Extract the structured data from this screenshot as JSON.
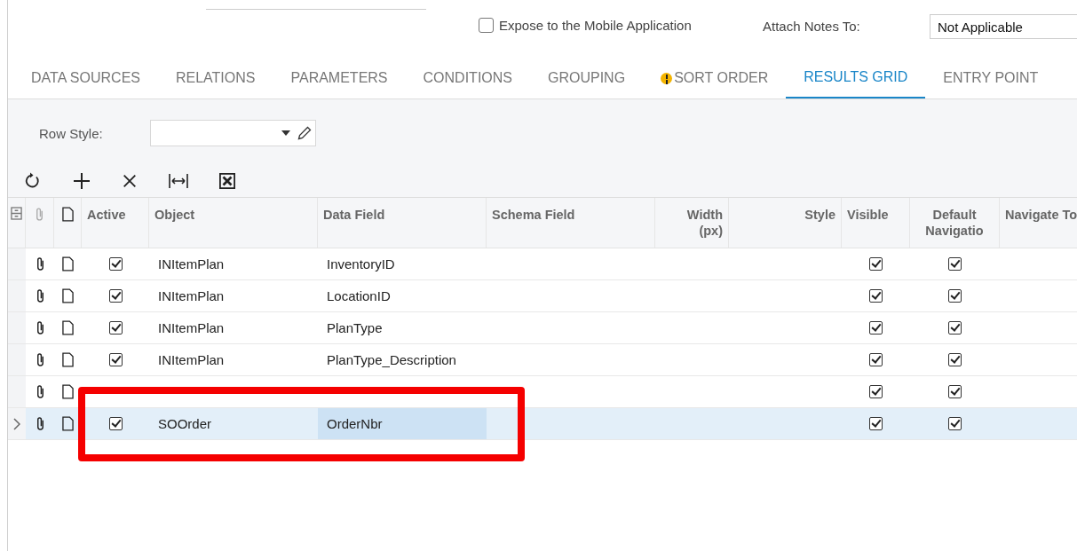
{
  "header_form": {
    "mobile_checkbox": {
      "label": "Expose to the Mobile Application",
      "checked": false
    },
    "attach_notes": {
      "label": "Attach Notes To:",
      "value": "Not Applicable"
    }
  },
  "tabs": [
    {
      "label": "DATA SOURCES",
      "selected": false,
      "warning": false
    },
    {
      "label": "RELATIONS",
      "selected": false,
      "warning": false
    },
    {
      "label": "PARAMETERS",
      "selected": false,
      "warning": false
    },
    {
      "label": "CONDITIONS",
      "selected": false,
      "warning": false
    },
    {
      "label": "GROUPING",
      "selected": false,
      "warning": false
    },
    {
      "label": "SORT ORDER",
      "selected": false,
      "warning": true
    },
    {
      "label": "RESULTS GRID",
      "selected": true,
      "warning": false
    },
    {
      "label": "ENTRY POINT",
      "selected": false,
      "warning": false
    }
  ],
  "row_style": {
    "label": "Row Style:"
  },
  "grid": {
    "columns": [
      "Active",
      "Object",
      "Data Field",
      "Schema Field",
      "Width (px)",
      "Style",
      "Visible",
      "Default Navigatio",
      "Navigate To"
    ],
    "rows": [
      {
        "active": true,
        "object": "INItemPlan",
        "data_field": "InventoryID",
        "visible": true,
        "default_navigation": true,
        "selected": false
      },
      {
        "active": true,
        "object": "INItemPlan",
        "data_field": "LocationID",
        "visible": true,
        "default_navigation": true,
        "selected": false
      },
      {
        "active": true,
        "object": "INItemPlan",
        "data_field": "PlanType",
        "visible": true,
        "default_navigation": true,
        "selected": false
      },
      {
        "active": true,
        "object": "INItemPlan",
        "data_field": "PlanType_Description",
        "visible": true,
        "default_navigation": true,
        "selected": false
      },
      {
        "visible": true,
        "default_navigation": true,
        "selected": false
      },
      {
        "active": true,
        "object": "SOOrder",
        "data_field": "OrderNbr",
        "visible": true,
        "default_navigation": true,
        "selected": true
      }
    ]
  }
}
